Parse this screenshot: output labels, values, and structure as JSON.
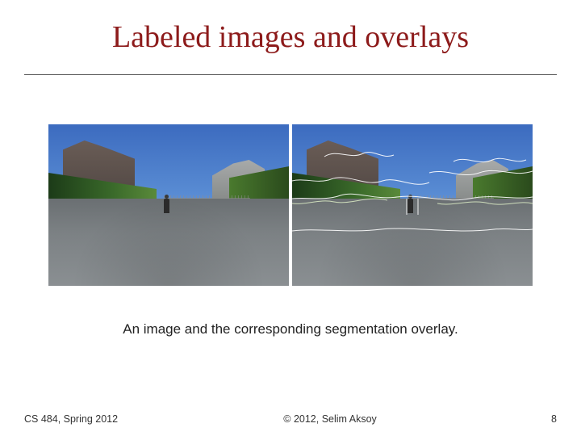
{
  "title": "Labeled images and overlays",
  "caption": "An image and the corresponding segmentation overlay.",
  "footer": {
    "course": "CS 484, Spring 2012",
    "copyright": "© 2012, Selim Aksoy",
    "page": "8"
  },
  "images": {
    "left_alt": "campus-street-photo",
    "right_alt": "campus-street-photo-segmentation-overlay"
  }
}
